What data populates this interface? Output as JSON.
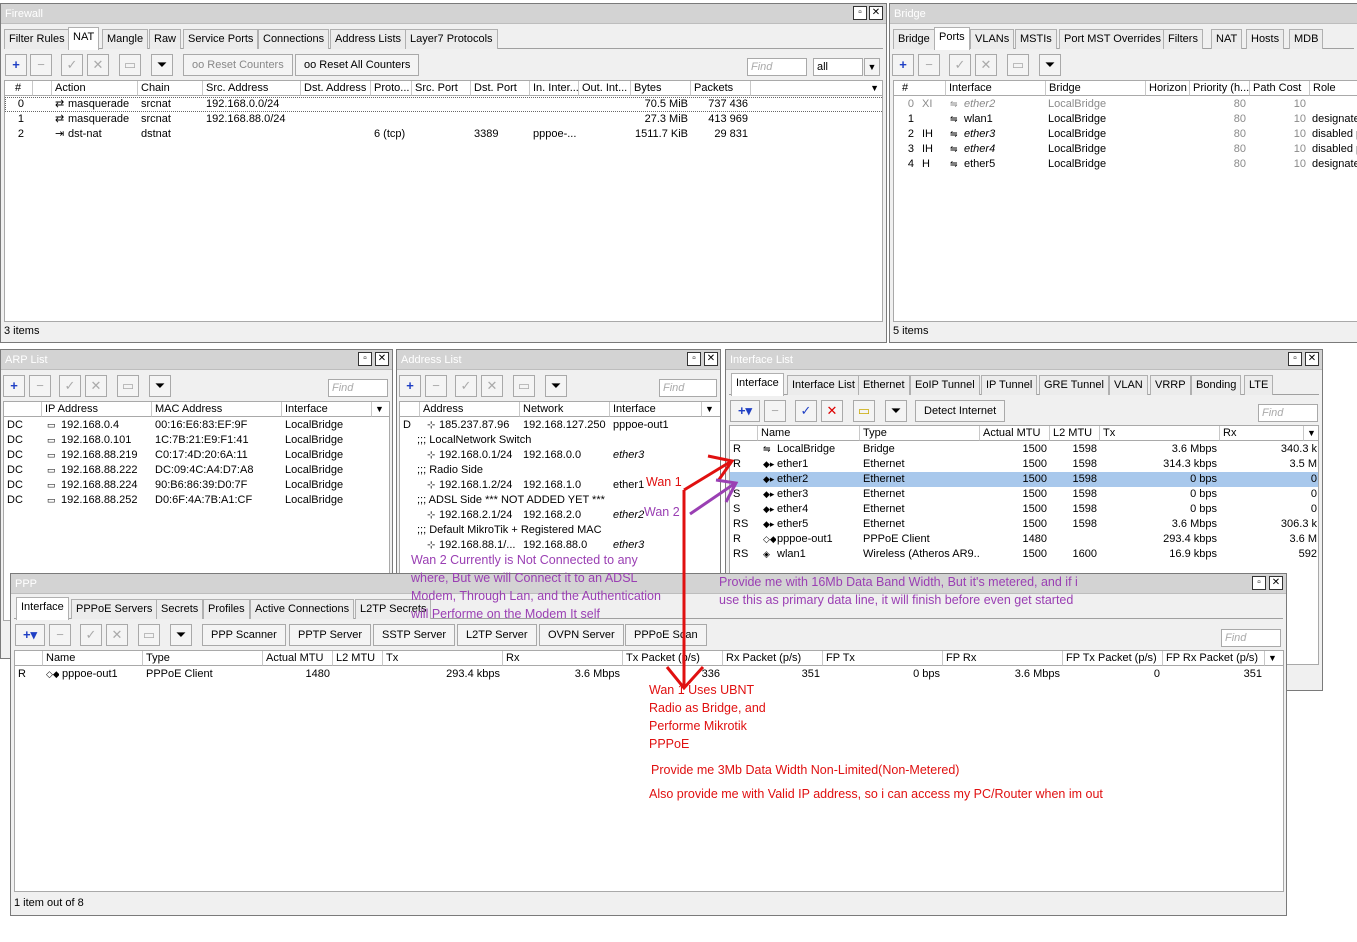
{
  "firewall": {
    "title": "Firewall",
    "tabs": [
      "Filter Rules",
      "NAT",
      "Mangle",
      "Raw",
      "Service Ports",
      "Connections",
      "Address Lists",
      "Layer7 Protocols"
    ],
    "reset_counters": "Reset Counters",
    "reset_all_counters": "Reset All Counters",
    "find": "Find",
    "filter_value": "all",
    "columns": [
      "#",
      "Action",
      "Chain",
      "Src. Address",
      "Dst. Address",
      "Proto...",
      "Src. Port",
      "Dst. Port",
      "In. Inter...",
      "Out. Int...",
      "Bytes",
      "Packets"
    ],
    "rows": [
      [
        "0",
        "masquerade",
        "srcnat",
        "192.168.0.0/24",
        "",
        "",
        "",
        "",
        "",
        "",
        "70.5 MiB",
        "737 436"
      ],
      [
        "1",
        "masquerade",
        "srcnat",
        "192.168.88.0/24",
        "",
        "",
        "",
        "",
        "",
        "",
        "27.3 MiB",
        "413 969"
      ],
      [
        "2",
        "dst-nat",
        "dstnat",
        "",
        "",
        "6 (tcp)",
        "",
        "3389",
        "pppoe-...",
        "",
        "1511.7 KiB",
        "29 831"
      ]
    ],
    "status": "3 items"
  },
  "bridge": {
    "title": "Bridge",
    "tabs": [
      "Bridge",
      "Ports",
      "VLANs",
      "MSTIs",
      "Port MST Overrides",
      "Filters",
      "NAT",
      "Hosts",
      "MDB"
    ],
    "columns": [
      "#",
      "Interface",
      "Bridge",
      "Horizon",
      "Priority (h...",
      "Path Cost",
      "Role"
    ],
    "rows": [
      [
        "0",
        "XI",
        "ether2",
        "LocalBridge",
        "",
        "80",
        "10",
        ""
      ],
      [
        "1",
        "",
        "wlan1",
        "LocalBridge",
        "",
        "80",
        "10",
        "designate"
      ],
      [
        "2",
        "IH",
        "ether3",
        "LocalBridge",
        "",
        "80",
        "10",
        "disabled p"
      ],
      [
        "3",
        "IH",
        "ether4",
        "LocalBridge",
        "",
        "80",
        "10",
        "disabled p"
      ],
      [
        "4",
        "H",
        "ether5",
        "LocalBridge",
        "",
        "80",
        "10",
        "designate"
      ]
    ],
    "status": "5 items"
  },
  "arp": {
    "title": "ARP List",
    "find": "Find",
    "columns": [
      "IP Address",
      "MAC Address",
      "Interface"
    ],
    "rows": [
      [
        "DC",
        "192.168.0.4",
        "00:16:E6:83:EF:9F",
        "LocalBridge"
      ],
      [
        "DC",
        "192.168.0.101",
        "1C:7B:21:E9:F1:41",
        "LocalBridge"
      ],
      [
        "DC",
        "192.168.88.219",
        "C0:17:4D:20:6A:11",
        "LocalBridge"
      ],
      [
        "DC",
        "192.168.88.222",
        "DC:09:4C:A4:D7:A8",
        "LocalBridge"
      ],
      [
        "DC",
        "192.168.88.224",
        "90:B6:86:39:D0:7F",
        "LocalBridge"
      ],
      [
        "DC",
        "192.168.88.252",
        "D0:6F:4A:7B:A1:CF",
        "LocalBridge"
      ]
    ]
  },
  "address": {
    "title": "Address List",
    "find": "Find",
    "columns": [
      "Address",
      "Network",
      "Interface"
    ],
    "rows": [
      {
        "flag": "D",
        "address": "185.237.87.96",
        "network": "192.168.127.250",
        "iface": "pppoe-out1"
      },
      {
        "comment": ";;; LocalNetwork Switch"
      },
      {
        "address": "192.168.0.1/24",
        "network": "192.168.0.0",
        "iface": "ether3",
        "italic": true
      },
      {
        "comment": ";;; Radio Side"
      },
      {
        "address": "192.168.1.2/24",
        "network": "192.168.1.0",
        "iface": "ether1"
      },
      {
        "comment": ";;; ADSL Side *** NOT ADDED YET ***"
      },
      {
        "address": "192.168.2.1/24",
        "network": "192.168.2.0",
        "iface": "ether2",
        "italic": true
      },
      {
        "comment": ";;; Default MikroTik +  Registered MAC"
      },
      {
        "address": "192.168.88.1/...",
        "network": "192.168.88.0",
        "iface": "ether3",
        "italic": true
      }
    ]
  },
  "iflist": {
    "title": "Interface List",
    "tabs": [
      "Interface",
      "Interface List",
      "Ethernet",
      "EoIP Tunnel",
      "IP Tunnel",
      "GRE Tunnel",
      "VLAN",
      "VRRP",
      "Bonding",
      "LTE"
    ],
    "detect": "Detect Internet",
    "find": "Find",
    "columns": [
      "Name",
      "Type",
      "Actual MTU",
      "L2 MTU",
      "Tx",
      "Rx"
    ],
    "rows": [
      [
        "R",
        "LocalBridge",
        "Bridge",
        "1500",
        "1598",
        "3.6 Mbps",
        "340.3 k"
      ],
      [
        "R",
        "ether1",
        "Ethernet",
        "1500",
        "1598",
        "314.3 kbps",
        "3.5 M"
      ],
      [
        "",
        "ether2",
        "Ethernet",
        "1500",
        "1598",
        "0 bps",
        "0"
      ],
      [
        "S",
        "ether3",
        "Ethernet",
        "1500",
        "1598",
        "0 bps",
        "0"
      ],
      [
        "S",
        "ether4",
        "Ethernet",
        "1500",
        "1598",
        "0 bps",
        "0"
      ],
      [
        "RS",
        "ether5",
        "Ethernet",
        "1500",
        "1598",
        "3.6 Mbps",
        "306.3 k"
      ],
      [
        "R",
        "pppoe-out1",
        "PPPoE Client",
        "1480",
        "",
        "293.4 kbps",
        "3.6 M"
      ],
      [
        "RS",
        "wlan1",
        "Wireless (Atheros AR9...",
        "1500",
        "1600",
        "16.9 kbps",
        "592"
      ]
    ]
  },
  "ppp": {
    "title": "PPP",
    "tabs": [
      "Interface",
      "PPPoE Servers",
      "Secrets",
      "Profiles",
      "Active Connections",
      "L2TP Secrets"
    ],
    "buttons": [
      "PPP Scanner",
      "PPTP Server",
      "SSTP Server",
      "L2TP Server",
      "OVPN Server",
      "PPPoE Scan"
    ],
    "find": "Find",
    "columns": [
      "Name",
      "Type",
      "Actual MTU",
      "L2 MTU",
      "Tx",
      "Rx",
      "Tx Packet (p/s)",
      "Rx Packet (p/s)",
      "FP Tx",
      "FP Rx",
      "FP Tx Packet (p/s)",
      "FP Rx Packet (p/s)"
    ],
    "row": [
      "R",
      "pppoe-out1",
      "PPPoE Client",
      "1480",
      "",
      "293.4 kbps",
      "3.6 Mbps",
      "336",
      "351",
      "0 bps",
      "3.6 Mbps",
      "0",
      "351"
    ],
    "status": "1 item out of 8"
  },
  "annotations": {
    "wan1": "Wan 1",
    "wan2": "Wan 2",
    "wan2_note": [
      "Wan 2 Currently is Not Connected to any",
      "where, But we will Connect it to an ADSL",
      "Modem, Through Lan, and the Authentication",
      "will Performe on the Modem It self"
    ],
    "wan2_bw": [
      "Provide me with 16Mb Data Band Width, But it's metered, and if i",
      "use this as primary data line, it will finish before even get started"
    ],
    "wan1_note": [
      "Wan 1 Uses UBNT",
      "Radio as Bridge, and",
      "Performe Mikrotik",
      "PPPoE"
    ],
    "wan1_bw": "Provide me 3Mb Data Width Non-Limited(Non-Metered)",
    "wan1_ip": "Also provide me with Valid IP address, so i can access my PC/Router when im out"
  },
  "colors": {
    "annotation_red": "#e01010",
    "annotation_purple": "#9a3fb3",
    "selection": "#a8c8ec",
    "plus_blue": "#1f3fc4"
  }
}
